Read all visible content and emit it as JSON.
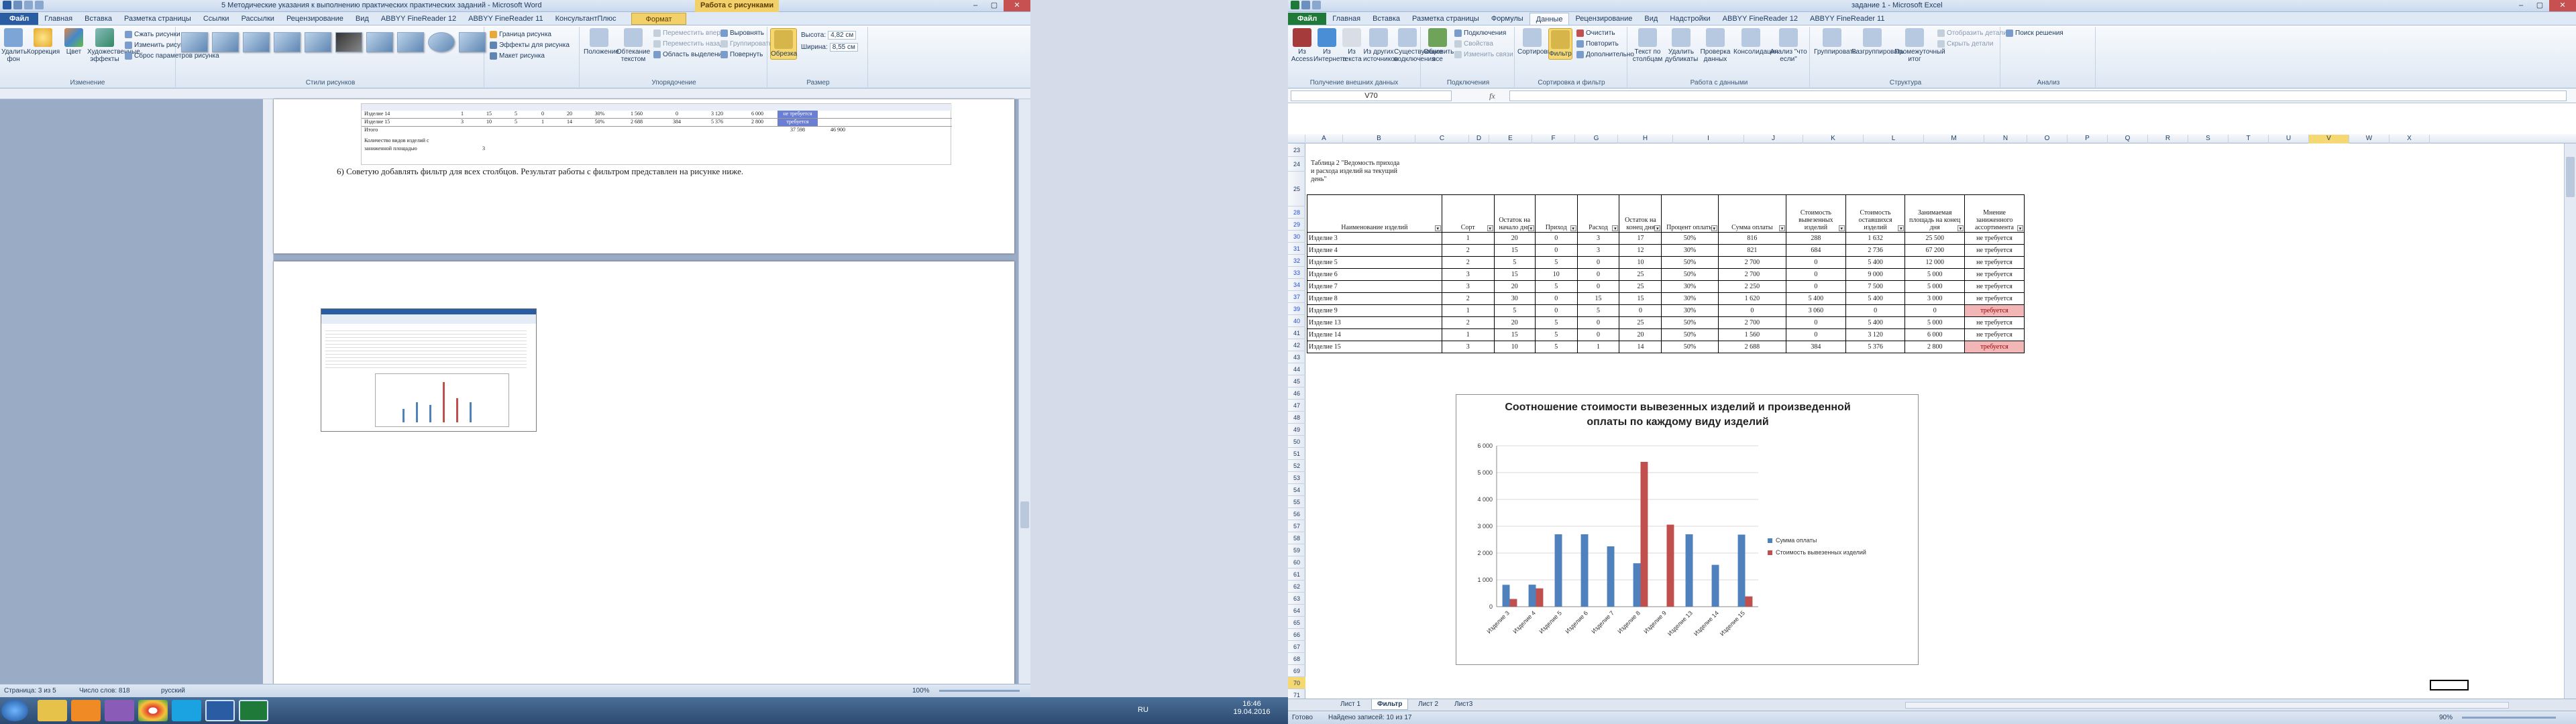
{
  "word": {
    "title": "5 Методические указания к выполнению практических практических заданий - Microsoft Word",
    "context_tab": "Работа с рисунками",
    "tabs": [
      "Файл",
      "Главная",
      "Вставка",
      "Разметка страницы",
      "Ссылки",
      "Рассылки",
      "Рецензирование",
      "Вид",
      "ABBYY FineReader 12",
      "ABBYY FineReader 11",
      "КонсультантПлюс",
      "Формат"
    ],
    "ribbon": {
      "remove_bg": "Удалить фон",
      "correction": "Коррекция",
      "color": "Цвет",
      "art_effects": "Художественные эффекты",
      "compress": "Сжать рисунки",
      "change_pic": "Изменить рисунок",
      "reset_pic": "Сброс параметров рисунка",
      "grp_change": "Изменение",
      "grp_styles": "Стили рисунков",
      "border": "Граница рисунка",
      "effects": "Эффекты для рисунка",
      "layout": "Макет рисунка",
      "position": "Положение",
      "wrap": "Обтекание текстом",
      "forward": "Переместить вперед",
      "backward": "Переместить назад",
      "sel_pane": "Область выделения",
      "align": "Выровнять",
      "group": "Группировать",
      "rotate": "Повернуть",
      "grp_arrange": "Упорядочение",
      "crop": "Обрезка",
      "height_lbl": "Высота:",
      "height_val": "4,82 см",
      "width_lbl": "Ширина:",
      "width_val": "8,55 см",
      "grp_size": "Размер"
    },
    "paragraph": "6)   Советую добавлять фильтр для всех столбцов. Результат работы с фильтром представлен на рисунке ниже.",
    "status": {
      "page": "Страница: 3 из 5",
      "words": "Число слов: 818",
      "lang": "русский",
      "zoom": "100%"
    },
    "mini_rows": [
      {
        "name": "Изделие 14",
        "vals": [
          "1",
          "15",
          "5",
          "0",
          "20",
          "30%",
          "1 560",
          "0",
          "3 120",
          "6 000"
        ],
        "flag": "не требуется"
      },
      {
        "name": "Изделие 15",
        "vals": [
          "3",
          "10",
          "5",
          "1",
          "14",
          "50%",
          "2 688",
          "384",
          "5 376",
          "2 800"
        ],
        "flag": "требуется"
      },
      {
        "name": "Итого",
        "vals": [
          "",
          "",
          "",
          "",
          "",
          "",
          "",
          "",
          "37 598",
          "46 900"
        ],
        "flag": ""
      }
    ],
    "mini_note1": "Количество видов изделий с",
    "mini_note2": "заниженной площадью",
    "mini_note_val": "3"
  },
  "taskbar": {
    "lang": "RU",
    "time": "16:46",
    "date": "19.04.2016"
  },
  "excel": {
    "title": "задание 1 - Microsoft Excel",
    "tabs": [
      "Файл",
      "Главная",
      "Вставка",
      "Разметка страницы",
      "Формулы",
      "Данные",
      "Рецензирование",
      "Вид",
      "Надстройки",
      "ABBYY FineReader 12",
      "ABBYY FineReader 11"
    ],
    "ribbon": {
      "from_access": "Из Access",
      "from_web": "Из Интернета",
      "from_text": "Из текста",
      "from_other": "Из других источников",
      "existing": "Существующие подключения",
      "grp_get": "Получение внешних данных",
      "refresh": "Обновить все",
      "connections": "Подключения",
      "properties": "Свойства",
      "edit_links": "Изменить связи",
      "grp_conn": "Подключения",
      "sort": "Сортировка",
      "filter": "Фильтр",
      "clear": "Очистить",
      "reapply": "Повторить",
      "advanced": "Дополнительно",
      "grp_sort": "Сортировка и фильтр",
      "text_to_cols": "Текст по столбцам",
      "remove_dup": "Удалить дубликаты",
      "validation": "Проверка данных",
      "consolidate": "Консолидация",
      "whatif": "Анализ \"что если\"",
      "grp_data": "Работа с данными",
      "group": "Группировать",
      "ungroup": "Разгруппировать",
      "subtotal": "Промежуточный итог",
      "show_detail": "Отобразить детали",
      "hide_detail": "Скрыть детали",
      "grp_outline": "Структура",
      "solver": "Поиск решения",
      "grp_analysis": "Анализ"
    },
    "name_box": "V70",
    "fx": "fx",
    "columns": [
      "A",
      "B",
      "C",
      "D",
      "E",
      "F",
      "G",
      "H",
      "I",
      "J",
      "K",
      "L",
      "M",
      "N",
      "O",
      "P",
      "Q",
      "R",
      "S",
      "T",
      "U",
      "V",
      "W",
      "X"
    ],
    "caption": [
      "Таблица 2 \"Ведомость прихода",
      "и расхода изделий на текущий",
      "день\""
    ],
    "headers": [
      "Наименование изделий",
      "Сорт",
      "Остаток на начало дня",
      "Приход",
      "Расход",
      "Остаток на конец дня",
      "Процент оплаты",
      "Сумма оплаты",
      "Стоимость вывезенных изделий",
      "Стоимость оставшихся изделий",
      "Занимаемая площадь на конец дня",
      "Мнение заниженного ассортимента"
    ],
    "rows": [
      {
        "r": "28",
        "c": [
          "Изделие 3",
          "1",
          "20",
          "0",
          "3",
          "17",
          "50%",
          "816",
          "288",
          "1 632",
          "25 500",
          "не требуется"
        ]
      },
      {
        "r": "29",
        "c": [
          "Изделие 4",
          "2",
          "15",
          "0",
          "3",
          "12",
          "30%",
          "821",
          "684",
          "2 736",
          "67 200",
          "не требуется"
        ]
      },
      {
        "r": "30",
        "c": [
          "Изделие 5",
          "2",
          "5",
          "5",
          "0",
          "10",
          "50%",
          "2 700",
          "0",
          "5 400",
          "12 000",
          "не требуется"
        ]
      },
      {
        "r": "31",
        "c": [
          "Изделие 6",
          "3",
          "15",
          "10",
          "0",
          "25",
          "50%",
          "2 700",
          "0",
          "9 000",
          "5 000",
          "не требуется"
        ]
      },
      {
        "r": "32",
        "c": [
          "Изделие 7",
          "3",
          "20",
          "5",
          "0",
          "25",
          "30%",
          "2 250",
          "0",
          "7 500",
          "5 000",
          "не требуется"
        ]
      },
      {
        "r": "33",
        "c": [
          "Изделие 8",
          "2",
          "30",
          "0",
          "15",
          "15",
          "30%",
          "1 620",
          "5 400",
          "5 400",
          "3 000",
          "не требуется"
        ]
      },
      {
        "r": "34",
        "c": [
          "Изделие 9",
          "1",
          "5",
          "0",
          "5",
          "0",
          "30%",
          "0",
          "3 060",
          "0",
          "0",
          "требуется"
        ]
      },
      {
        "r": "37",
        "c": [
          "Изделие 13",
          "2",
          "20",
          "5",
          "0",
          "25",
          "50%",
          "2 700",
          "0",
          "5 400",
          "5 000",
          "не требуется"
        ]
      },
      {
        "r": "39",
        "c": [
          "Изделие 14",
          "1",
          "15",
          "5",
          "0",
          "20",
          "50%",
          "1 560",
          "0",
          "3 120",
          "6 000",
          "не требуется"
        ]
      },
      {
        "r": "40",
        "c": [
          "Изделие 15",
          "3",
          "10",
          "5",
          "1",
          "14",
          "50%",
          "2 688",
          "384",
          "5 376",
          "2 800",
          "требуется"
        ]
      }
    ],
    "sheets": [
      "Лист 1",
      "Фильтр",
      "Лист 2",
      "Лист3"
    ],
    "status": {
      "ready": "Готово",
      "found": "Найдено записей: 10 из 17",
      "zoom": "90%"
    }
  },
  "chart_data": {
    "type": "bar",
    "title": "Соотношение стоимости вывезенных изделий и произведенной оплаты по каждому виду изделий",
    "categories": [
      "Изделие 3",
      "Изделие 4",
      "Изделие 5",
      "Изделие 6",
      "Изделие 7",
      "Изделие 8",
      "Изделие 9",
      "Изделие 13",
      "Изделие 14",
      "Изделие 15"
    ],
    "series": [
      {
        "name": "Сумма оплаты",
        "color": "#4f81bd",
        "values": [
          816,
          821,
          2700,
          2700,
          2250,
          1620,
          0,
          2700,
          1560,
          2688
        ]
      },
      {
        "name": "Стоимость вывезенных изделий",
        "color": "#c0504d",
        "values": [
          288,
          684,
          0,
          0,
          0,
          5400,
          3060,
          0,
          0,
          384
        ]
      }
    ],
    "ylim": [
      0,
      6000
    ],
    "yticks": [
      "0",
      "1 000",
      "2 000",
      "3 000",
      "4 000",
      "5 000",
      "6 000"
    ],
    "legend": "right"
  }
}
